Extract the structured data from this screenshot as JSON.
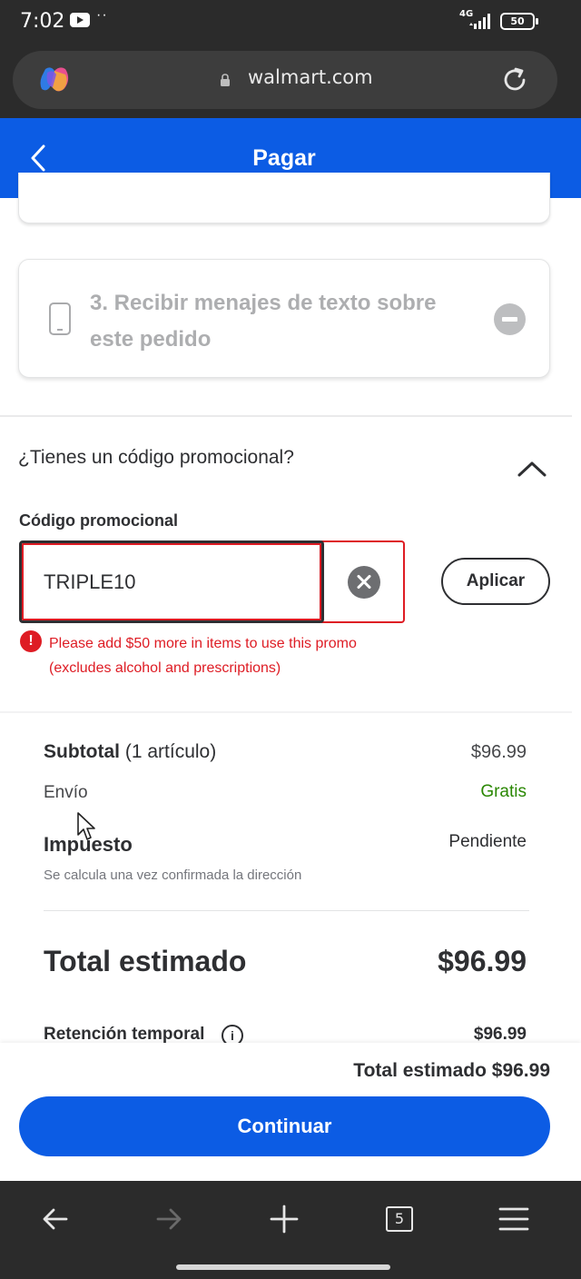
{
  "status_bar": {
    "time": "7:02",
    "network": "4G",
    "battery": "50"
  },
  "browser": {
    "url": "walmart.com"
  },
  "header": {
    "title": "Pagar"
  },
  "step_card": {
    "title": "3. Recibir menajes de texto sobre este pedido"
  },
  "promo": {
    "question": "¿Tienes un código promocional?",
    "field_label": "Código promocional",
    "value": "TRIPLE10",
    "apply_label": "Aplicar",
    "error": "Please add $50 more in items to use this promo (excludes alcohol and prescriptions)"
  },
  "summary": {
    "subtotal_label": "Subtotal",
    "subtotal_count": "(1 artículo)",
    "subtotal_value": "$96.99",
    "shipping_label": "Envío",
    "shipping_value": "Gratis",
    "tax_label": "Impuesto",
    "tax_value": "Pendiente",
    "tax_note": "Se calcula una vez confirmada la dirección",
    "total_label": "Total estimado",
    "total_value": "$96.99",
    "hold_label": "Retención temporal",
    "hold_value": "$96.99"
  },
  "footer": {
    "total_text": "Total estimado $96.99",
    "continue_label": "Continuar"
  },
  "bottom_nav": {
    "tab_count": "5"
  },
  "colors": {
    "brand_blue": "#0c5ce4",
    "error_red": "#de1c24",
    "free_green": "#2a8703"
  }
}
